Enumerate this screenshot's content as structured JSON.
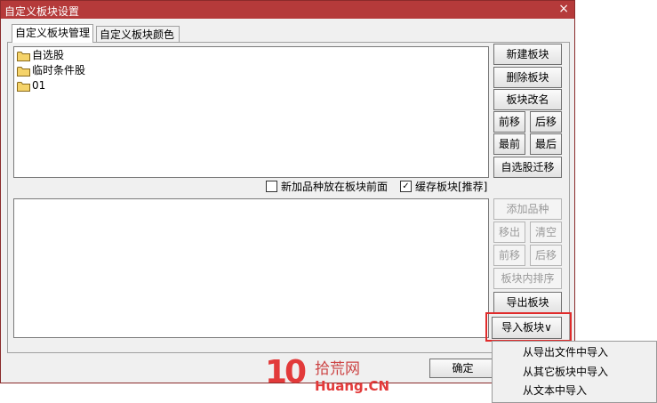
{
  "window": {
    "title": "自定义板块设置",
    "close_icon": "×"
  },
  "tabs": [
    {
      "label": "自定义板块管理",
      "active": true
    },
    {
      "label": "自定义板块颜色",
      "active": false
    }
  ],
  "block_list": {
    "items": [
      {
        "label": "自选股",
        "icon": "folder-icon"
      },
      {
        "label": "临时条件股",
        "icon": "folder-icon"
      },
      {
        "label": "01",
        "icon": "folder-icon"
      }
    ]
  },
  "block_buttons": {
    "new": "新建板块",
    "delete": "删除板块",
    "rename": "板块改名",
    "move_up": "前移",
    "move_down": "后移",
    "first": "最前",
    "last": "最后",
    "migrate": "自选股迁移"
  },
  "options": {
    "add_front": {
      "label": "新加品种放在板块前面",
      "checked": false
    },
    "cache": {
      "label": "缓存板块[推荐]",
      "checked": true
    }
  },
  "stock_buttons": {
    "add": "添加品种",
    "remove": "移出",
    "clear": "清空",
    "move_up": "前移",
    "move_down": "后移",
    "sort": "板块内排序",
    "export": "导出板块",
    "import": "导入板块∨"
  },
  "ok_button": "确定",
  "import_menu": [
    "从导出文件中导入",
    "从其它板块中导入",
    "从文本中导入"
  ],
  "watermark": {
    "logo": "10",
    "cn": "拾荒网",
    "en": "Huang.CN"
  },
  "colors": {
    "titlebar": "#b53a3a",
    "highlight": "#e02b2b",
    "folder": "#f5d36a"
  }
}
